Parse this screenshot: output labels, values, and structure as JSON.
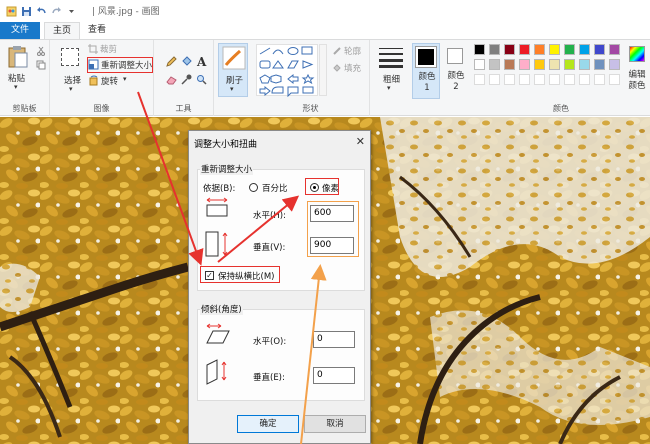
{
  "window": {
    "title": "| 风景.jpg - 画图"
  },
  "tabs": {
    "file": "文件",
    "home": "主页",
    "view": "查看"
  },
  "ribbon": {
    "clipboard": {
      "paste": "粘贴",
      "group": "剪贴板"
    },
    "image": {
      "select": "选择",
      "crop": "裁剪",
      "resize": "重新调整大小",
      "rotate": "旋转",
      "group": "图像"
    },
    "tools": {
      "group": "工具"
    },
    "brushes": {
      "label": "刷子"
    },
    "shapes": {
      "outline": "轮廓",
      "fill": "填充",
      "group": "形状"
    },
    "size": {
      "label": "粗细"
    },
    "color1": "颜色 1",
    "color2": "颜色 2",
    "colors": {
      "group": "颜色",
      "edit": "编辑颜色"
    }
  },
  "palette": [
    "#000000",
    "#7f7f7f",
    "#880015",
    "#ed1c24",
    "#ff7f27",
    "#fff200",
    "#22b14c",
    "#00a2e8",
    "#3f48cc",
    "#a349a4",
    "#ffffff",
    "#c3c3c3",
    "#b97a57",
    "#ffaec9",
    "#ffc90e",
    "#efe4b0",
    "#b5e61d",
    "#99d9ea",
    "#7092be",
    "#c8bfe7"
  ],
  "dialog": {
    "title": "调整大小和扭曲",
    "resize_section": "重新调整大小",
    "basis_label": "依据(B):",
    "percent": "百分比",
    "pixels": "像素",
    "horizontal_label": "水平(H):",
    "horizontal_value": "600",
    "vertical_label": "垂直(V):",
    "vertical_value": "900",
    "keep_ratio": "保持纵横比(M)",
    "skew_section": "倾斜(角度)",
    "skew_h_label": "水平(O):",
    "skew_h_value": "0",
    "skew_v_label": "垂直(E):",
    "skew_v_value": "0",
    "ok": "确定",
    "cancel": "取消"
  }
}
